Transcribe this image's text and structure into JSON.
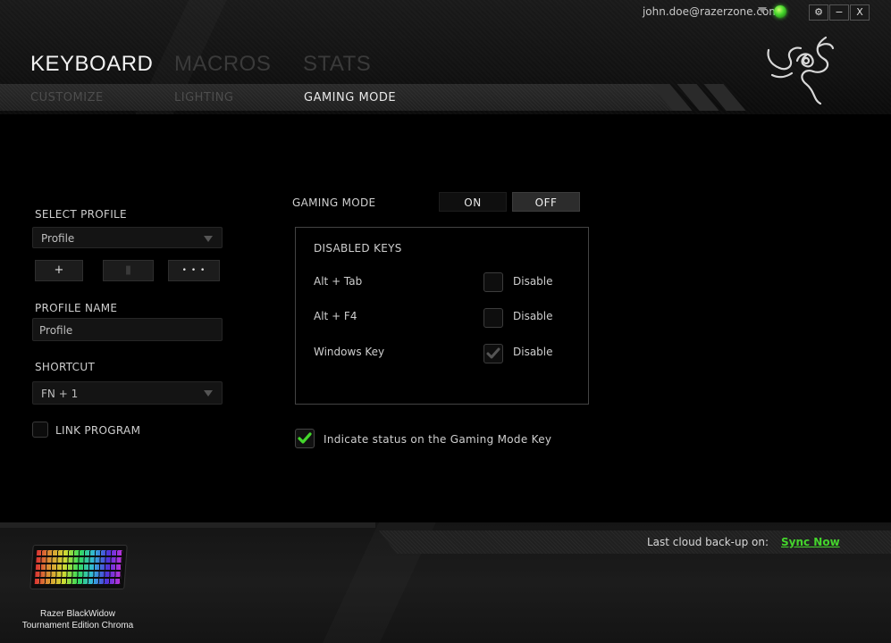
{
  "window": {
    "account_email": "john.doe@razerzone.com",
    "settings_glyph": "⚙",
    "minimize_glyph": "−",
    "close_glyph": "X"
  },
  "main_tabs": [
    {
      "label": "KEYBOARD",
      "active": true
    },
    {
      "label": "MACROS",
      "active": false
    },
    {
      "label": "STATS",
      "active": false
    }
  ],
  "sub_tabs": [
    {
      "label": "CUSTOMIZE",
      "active": false
    },
    {
      "label": "LIGHTING",
      "active": false
    },
    {
      "label": "GAMING MODE",
      "active": true
    }
  ],
  "profile": {
    "select_label": "SELECT PROFILE",
    "selected": "Profile",
    "add_glyph": "+",
    "delete_glyph": "▮",
    "more_glyph": "• • •",
    "name_label": "PROFILE NAME",
    "name_value": "Profile",
    "shortcut_label": "SHORTCUT",
    "shortcut_value": "FN + 1",
    "link_program_label": "LINK PROGRAM",
    "link_program_checked": false
  },
  "gaming_mode": {
    "label": "GAMING MODE",
    "on_label": "ON",
    "off_label": "OFF",
    "state": "off",
    "disabled_keys_title": "DISABLED KEYS",
    "keys": [
      {
        "label": "Alt + Tab",
        "action": "Disable",
        "checked": false
      },
      {
        "label": "Alt + F4",
        "action": "Disable",
        "checked": false
      },
      {
        "label": "Windows Key",
        "action": "Disable",
        "checked": true
      }
    ],
    "indicate_label": "Indicate status on the Gaming Mode Key",
    "indicate_checked": true
  },
  "footer": {
    "backup_label": "Last cloud back-up on:",
    "sync_label": "Sync Now",
    "device_line1": "Razer BlackWidow",
    "device_line2": "Tournament Edition Chroma"
  },
  "colors": {
    "accent_green": "#44d62c",
    "sync_link_green": "#44d62c",
    "background": "#000000"
  }
}
